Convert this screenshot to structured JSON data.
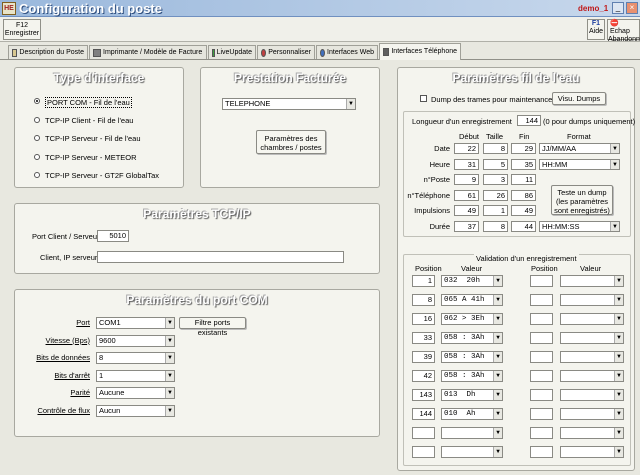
{
  "window": {
    "title": "Configuration du poste",
    "user": "demo_1",
    "logo": "HE"
  },
  "toolbar": {
    "save_key": "F12",
    "save_label": "Enregistrer",
    "help_key": "F1",
    "help_label": "Aide",
    "cancel_label": "Abandonner",
    "close_label": "Echap"
  },
  "tabs": [
    "Description du Poste",
    "Imprimante / Modèle de Facture",
    "LiveUpdate",
    "Personnaliser",
    "Interfaces Web",
    "Interfaces Téléphone"
  ],
  "type_interface": {
    "title": "Type d'interface",
    "options": [
      "PORT COM - Fil de l'eau",
      "TCP-IP Client - Fil de l'eau",
      "TCP-IP Serveur - Fil de l'eau",
      "TCP-IP Serveur - METEOR",
      "TCP-IP Serveur - GT2F GlobalTax"
    ],
    "selected_index": 0
  },
  "prestation": {
    "title": "Prestation Facturée",
    "value": "TELEPHONE",
    "button": "Paramètres des\nchambres / postes"
  },
  "tcpip": {
    "title": "Paramètres TCP/IP",
    "port_label": "Port Client / Serveur",
    "port_value": "5010",
    "client_label": "Client, IP serveur",
    "client_value": ""
  },
  "portcom": {
    "title": "Paramètres du port COM",
    "filter_button": "Filtre ports existants",
    "fields": [
      {
        "label": "Port",
        "value": "COM1"
      },
      {
        "label": "Vitesse (Bps)",
        "value": "9600"
      },
      {
        "label": "Bits de données",
        "value": "8"
      },
      {
        "label": "Bits d'arrêt",
        "value": "1"
      },
      {
        "label": "Parité",
        "value": "Aucune"
      },
      {
        "label": "Contrôle de flux",
        "value": "Aucun"
      }
    ]
  },
  "fil": {
    "title": "Paramètres fil de l'eau",
    "dump_label": "Dump des trames pour maintenance",
    "dump_checked": false,
    "visu_button": "Visu. Dumps",
    "length_label": "Longueur d'un enregistrement",
    "length_value": "144",
    "length_note": "(0 pour dumps uniquement)",
    "headers": [
      "Début",
      "Taille",
      "Fin",
      "Format"
    ],
    "rows": [
      {
        "label": "Date",
        "debut": "22",
        "taille": "8",
        "fin": "29",
        "format": "JJ/MM/AA"
      },
      {
        "label": "Heure",
        "debut": "31",
        "taille": "5",
        "fin": "35",
        "format": "HH:MM"
      },
      {
        "label": "n°Poste",
        "debut": "9",
        "taille": "3",
        "fin": "11",
        "format": ""
      },
      {
        "label": "n°Téléphone",
        "debut": "61",
        "taille": "26",
        "fin": "86",
        "format": ""
      },
      {
        "label": "Impulsions",
        "debut": "49",
        "taille": "1",
        "fin": "49",
        "format": ""
      },
      {
        "label": "Durée",
        "debut": "37",
        "taille": "8",
        "fin": "44",
        "format": "HH:MM:SS"
      }
    ],
    "test_button": "Teste un dump\n(les paramètres\nsont enregistrés)",
    "validation": {
      "title": "Validation d'un enregistrement",
      "headers": [
        "Position",
        "Valeur",
        "Position",
        "Valeur"
      ],
      "left": [
        {
          "pos": "1",
          "val": "032  20h"
        },
        {
          "pos": "8",
          "val": "065 A 41h"
        },
        {
          "pos": "16",
          "val": "062 > 3Eh"
        },
        {
          "pos": "33",
          "val": "058 : 3Ah"
        },
        {
          "pos": "39",
          "val": "058 : 3Ah"
        },
        {
          "pos": "42",
          "val": "058 : 3Ah"
        },
        {
          "pos": "143",
          "val": "013  Dh"
        },
        {
          "pos": "144",
          "val": "010  Ah"
        },
        {
          "pos": "",
          "val": ""
        },
        {
          "pos": "",
          "val": ""
        }
      ],
      "right_rows": 10
    }
  }
}
